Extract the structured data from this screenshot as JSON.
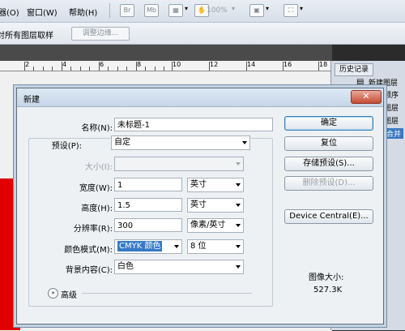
{
  "menubar": {
    "items": [
      "器(O)",
      "窗口(W)",
      "帮助(H)"
    ],
    "zoom": "100%"
  },
  "options_bar": {
    "partial_label": "对所有图层取样",
    "adjust_button": "调整边缘..."
  },
  "ruler": {
    "ticks": [
      "2",
      "4",
      "6",
      "8",
      "10",
      "12",
      "14",
      "16",
      "18"
    ]
  },
  "history_panel": {
    "tab": "历史记录",
    "items": [
      "新建图层",
      "顺序",
      "图层",
      "图层",
      "合并"
    ]
  },
  "dialog": {
    "title": "新建",
    "close": "✕",
    "name": {
      "label": "名称(N):",
      "value": "未标题-1"
    },
    "preset": {
      "label": "预设(P):",
      "value": "自定"
    },
    "size": {
      "label": "大小(I):",
      "value": ""
    },
    "width": {
      "label": "宽度(W):",
      "value": "1",
      "unit": "英寸"
    },
    "height": {
      "label": "高度(H):",
      "value": "1.5",
      "unit": "英寸"
    },
    "resolution": {
      "label": "分辨率(R):",
      "value": "300",
      "unit": "像素/英寸"
    },
    "color_mode": {
      "label": "颜色模式(M):",
      "value": "CMYK 颜色",
      "depth": "8 位"
    },
    "background": {
      "label": "背景内容(C):",
      "value": "白色"
    },
    "advanced": "高级",
    "buttons": {
      "ok": "确定",
      "reset": "复位",
      "save_preset": "存储预设(S)...",
      "delete_preset": "删除预设(D)...",
      "device_central": "Device Central(E)..."
    },
    "image_size_label": "图像大小:",
    "image_size_value": "527.3K"
  }
}
